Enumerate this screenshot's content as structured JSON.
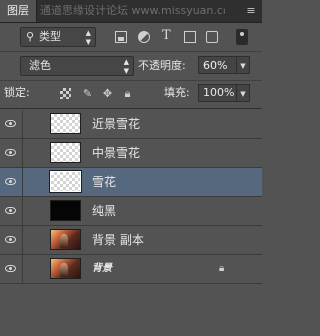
{
  "panel": {
    "tab_label": "图层",
    "title_text": "通道思缘设计论坛 www.missyuan.com"
  },
  "filter": {
    "kind_label": "类型",
    "icons": [
      "image-filter-icon",
      "adjustment-filter-icon",
      "text-filter-icon",
      "shape-filter-icon",
      "smart-object-filter-icon"
    ]
  },
  "blend": {
    "mode": "滤色",
    "opacity_label": "不透明度:",
    "opacity_value": "60%"
  },
  "lock": {
    "label": "锁定:",
    "fill_label": "填充:",
    "fill_value": "100%"
  },
  "layers": [
    {
      "name": "近景雪花",
      "thumb": "transparent",
      "selected": false
    },
    {
      "name": "中景雪花",
      "thumb": "transparent",
      "selected": false
    },
    {
      "name": "雪花",
      "thumb": "transparent",
      "selected": true
    },
    {
      "name": "纯黑",
      "thumb": "black",
      "selected": false
    },
    {
      "name": "背景 副本",
      "thumb": "photo",
      "selected": false
    },
    {
      "name": "背景",
      "thumb": "photo",
      "selected": false,
      "locked": true
    }
  ],
  "colors": {
    "panel_bg": "#535353",
    "selected_row": "#55687e",
    "tab_bar": "#2f2f2f"
  }
}
